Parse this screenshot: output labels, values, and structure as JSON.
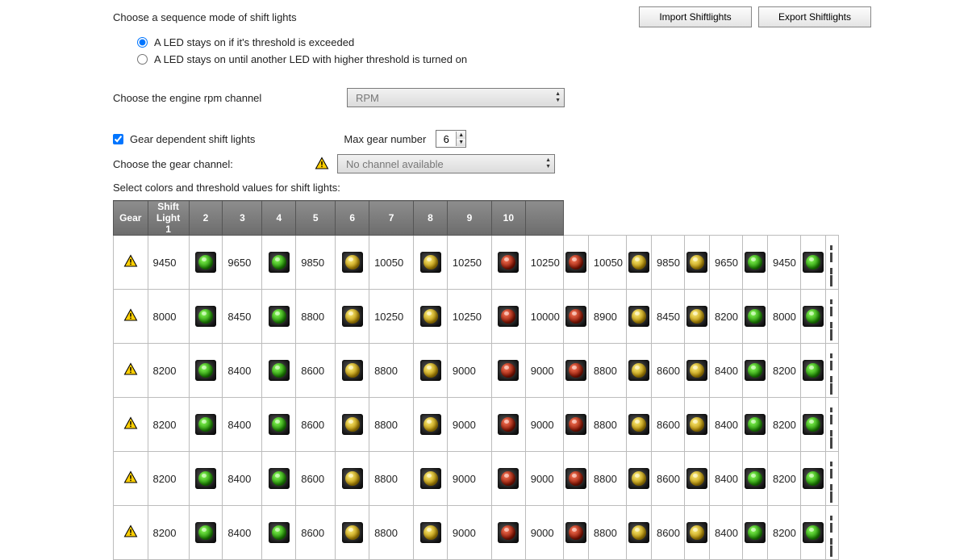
{
  "header": {
    "title": "Choose a sequence mode of shift lights",
    "buttons": {
      "import": "Import Shiftlights",
      "export": "Export Shiftlights"
    }
  },
  "sequence_mode": {
    "options": [
      "A LED stays on if it's threshold is exceeded",
      "A LED stays on until another LED with higher threshold is turned on"
    ],
    "selected_index": 0
  },
  "rpm_channel": {
    "label": "Choose the engine rpm channel",
    "value": "RPM"
  },
  "gear_dependent": {
    "label": "Gear dependent shift lights",
    "checked": true
  },
  "max_gear": {
    "label": "Max gear number",
    "value": "6"
  },
  "gear_channel": {
    "label": "Choose the gear channel:",
    "value": "No channel available",
    "warning": true
  },
  "table": {
    "caption": "Select colors and threshold values for shift lights:",
    "headers": [
      "Gear",
      "Shift Light 1",
      "2",
      "3",
      "4",
      "5",
      "6",
      "7",
      "8",
      "9",
      "10",
      ""
    ],
    "color_map": [
      "green",
      "green",
      "yellow",
      "yellow",
      "red",
      "red",
      "yellow",
      "yellow",
      "green",
      "green"
    ],
    "rows": [
      {
        "warn": true,
        "values": [
          "9450",
          "9650",
          "9850",
          "10050",
          "10250",
          "10250",
          "10050",
          "9850",
          "9650",
          "9450"
        ]
      },
      {
        "warn": true,
        "values": [
          "8000",
          "8450",
          "8800",
          "10250",
          "10250",
          "10000",
          "8900",
          "8450",
          "8200",
          "8000"
        ]
      },
      {
        "warn": true,
        "values": [
          "8200",
          "8400",
          "8600",
          "8800",
          "9000",
          "9000",
          "8800",
          "8600",
          "8400",
          "8200"
        ]
      },
      {
        "warn": true,
        "values": [
          "8200",
          "8400",
          "8600",
          "8800",
          "9000",
          "9000",
          "8800",
          "8600",
          "8400",
          "8200"
        ]
      },
      {
        "warn": true,
        "values": [
          "8200",
          "8400",
          "8600",
          "8800",
          "9000",
          "9000",
          "8800",
          "8600",
          "8400",
          "8200"
        ]
      },
      {
        "warn": true,
        "values": [
          "8200",
          "8400",
          "8600",
          "8800",
          "9000",
          "9000",
          "8800",
          "8600",
          "8400",
          "8200"
        ]
      }
    ]
  }
}
